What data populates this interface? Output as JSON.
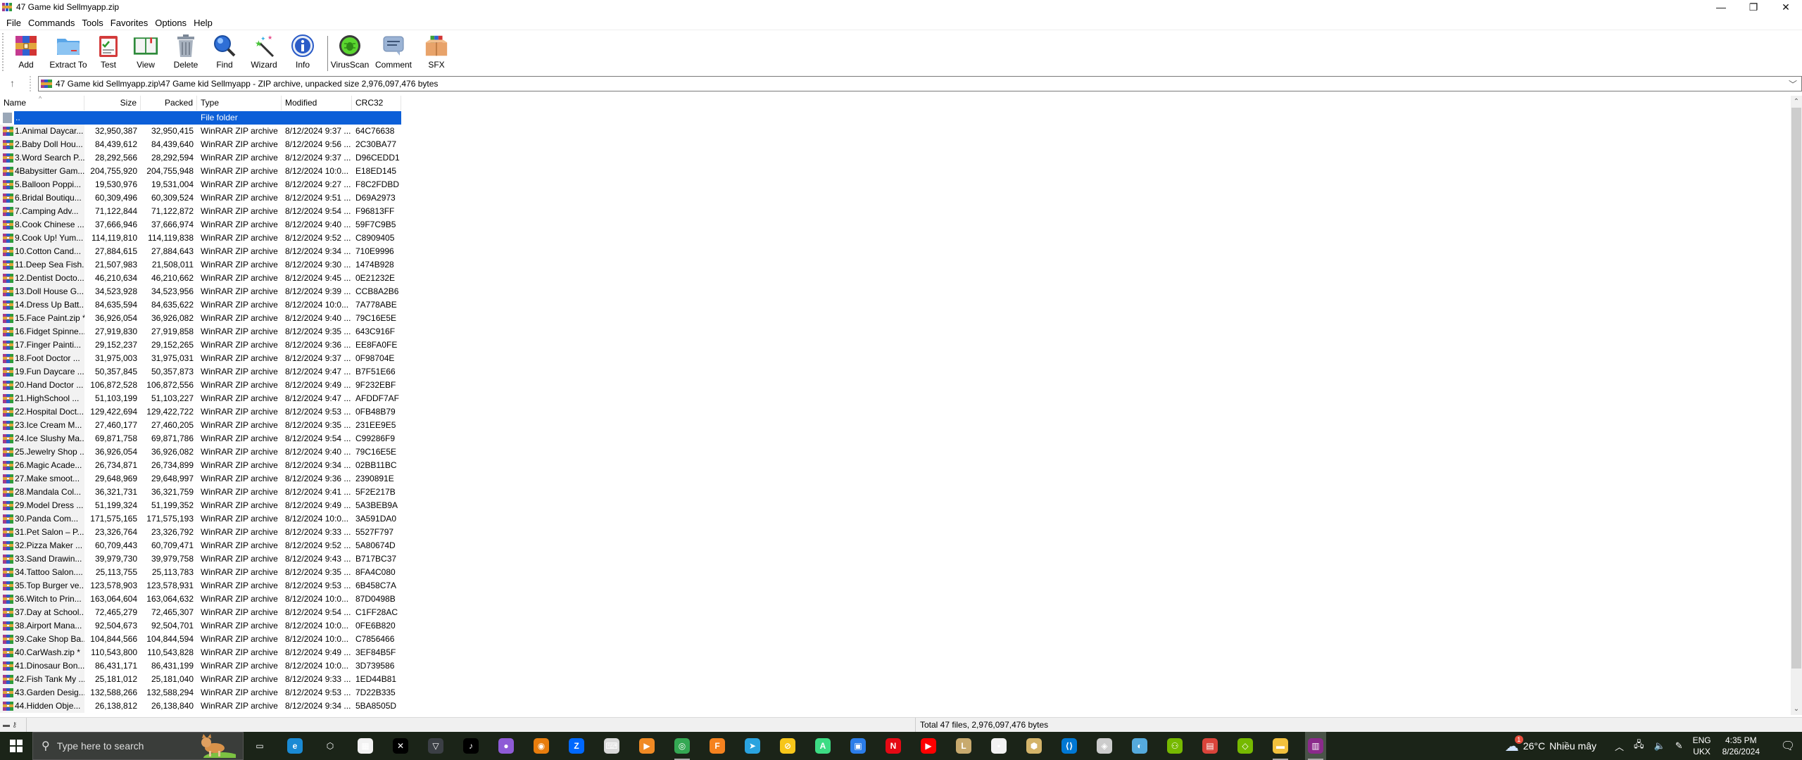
{
  "window": {
    "title": "47 Game kid Sellmyapp.zip",
    "controls": {
      "minimize": "—",
      "restore": "❐",
      "close": "✕"
    }
  },
  "menu": [
    "File",
    "Commands",
    "Tools",
    "Favorites",
    "Options",
    "Help"
  ],
  "toolbar": [
    {
      "label": "Add",
      "icon": "add-archive-icon"
    },
    {
      "label": "Extract To",
      "icon": "extract-folder-icon"
    },
    {
      "label": "Test",
      "icon": "test-clipboard-icon"
    },
    {
      "label": "View",
      "icon": "view-book-icon"
    },
    {
      "label": "Delete",
      "icon": "trash-icon"
    },
    {
      "label": "Find",
      "icon": "magnifier-icon"
    },
    {
      "label": "Wizard",
      "icon": "magic-wand-icon"
    },
    {
      "label": "Info",
      "icon": "info-icon"
    },
    {
      "label": "VirusScan",
      "icon": "virus-scan-icon"
    },
    {
      "label": "Comment",
      "icon": "comment-icon"
    },
    {
      "label": "SFX",
      "icon": "sfx-box-icon"
    }
  ],
  "address": {
    "path": "47 Game kid Sellmyapp.zip\\47 Game kid Sellmyapp - ZIP archive, unpacked size 2,976,097,476 bytes"
  },
  "columns": {
    "name": "Name",
    "size": "Size",
    "packed": "Packed",
    "type": "Type",
    "modified": "Modified",
    "crc": "CRC32"
  },
  "parent_row": {
    "name": "..",
    "type": "File folder"
  },
  "files": [
    {
      "name": "1.Animal Daycar...",
      "size": "32,950,387",
      "packed": "32,950,415",
      "type": "WinRAR ZIP archive",
      "modified": "8/12/2024 9:37 ...",
      "crc": "64C76638"
    },
    {
      "name": "2.Baby Doll Hou...",
      "size": "84,439,612",
      "packed": "84,439,640",
      "type": "WinRAR ZIP archive",
      "modified": "8/12/2024 9:56 ...",
      "crc": "2C30BA77"
    },
    {
      "name": "3.Word Search P...",
      "size": "28,292,566",
      "packed": "28,292,594",
      "type": "WinRAR ZIP archive",
      "modified": "8/12/2024 9:37 ...",
      "crc": "D96CEDD1"
    },
    {
      "name": "4Babysitter Gam...",
      "size": "204,755,920",
      "packed": "204,755,948",
      "type": "WinRAR ZIP archive",
      "modified": "8/12/2024 10:0...",
      "crc": "E18ED145"
    },
    {
      "name": "5.Balloon Poppi...",
      "size": "19,530,976",
      "packed": "19,531,004",
      "type": "WinRAR ZIP archive",
      "modified": "8/12/2024 9:27 ...",
      "crc": "F8C2FDBD"
    },
    {
      "name": "6.Bridal Boutiqu...",
      "size": "60,309,496",
      "packed": "60,309,524",
      "type": "WinRAR ZIP archive",
      "modified": "8/12/2024 9:51 ...",
      "crc": "D69A2973"
    },
    {
      "name": "7.Camping Adv...",
      "size": "71,122,844",
      "packed": "71,122,872",
      "type": "WinRAR ZIP archive",
      "modified": "8/12/2024 9:54 ...",
      "crc": "F96813FF"
    },
    {
      "name": "8.Cook Chinese ...",
      "size": "37,666,946",
      "packed": "37,666,974",
      "type": "WinRAR ZIP archive",
      "modified": "8/12/2024 9:40 ...",
      "crc": "59F7C9B5"
    },
    {
      "name": "9.Cook Up! Yum...",
      "size": "114,119,810",
      "packed": "114,119,838",
      "type": "WinRAR ZIP archive",
      "modified": "8/12/2024 9:52 ...",
      "crc": "C8909405"
    },
    {
      "name": "10.Cotton Cand...",
      "size": "27,884,615",
      "packed": "27,884,643",
      "type": "WinRAR ZIP archive",
      "modified": "8/12/2024 9:34 ...",
      "crc": "710E9996"
    },
    {
      "name": "11.Deep Sea Fish...",
      "size": "21,507,983",
      "packed": "21,508,011",
      "type": "WinRAR ZIP archive",
      "modified": "8/12/2024 9:30 ...",
      "crc": "1474B928"
    },
    {
      "name": "12.Dentist Docto...",
      "size": "46,210,634",
      "packed": "46,210,662",
      "type": "WinRAR ZIP archive",
      "modified": "8/12/2024 9:45 ...",
      "crc": "0E21232E"
    },
    {
      "name": "13.Doll House G...",
      "size": "34,523,928",
      "packed": "34,523,956",
      "type": "WinRAR ZIP archive",
      "modified": "8/12/2024 9:39 ...",
      "crc": "CCB8A2B6"
    },
    {
      "name": "14.Dress Up Batt...",
      "size": "84,635,594",
      "packed": "84,635,622",
      "type": "WinRAR ZIP archive",
      "modified": "8/12/2024 10:0...",
      "crc": "7A778ABE"
    },
    {
      "name": "15.Face Paint.zip *",
      "size": "36,926,054",
      "packed": "36,926,082",
      "type": "WinRAR ZIP archive",
      "modified": "8/12/2024 9:40 ...",
      "crc": "79C16E5E"
    },
    {
      "name": "16.Fidget Spinne...",
      "size": "27,919,830",
      "packed": "27,919,858",
      "type": "WinRAR ZIP archive",
      "modified": "8/12/2024 9:35 ...",
      "crc": "643C916F"
    },
    {
      "name": "17.Finger Painti...",
      "size": "29,152,237",
      "packed": "29,152,265",
      "type": "WinRAR ZIP archive",
      "modified": "8/12/2024 9:36 ...",
      "crc": "EE8FA0FE"
    },
    {
      "name": "18.Foot Doctor ...",
      "size": "31,975,003",
      "packed": "31,975,031",
      "type": "WinRAR ZIP archive",
      "modified": "8/12/2024 9:37 ...",
      "crc": "0F98704E"
    },
    {
      "name": "19.Fun Daycare ...",
      "size": "50,357,845",
      "packed": "50,357,873",
      "type": "WinRAR ZIP archive",
      "modified": "8/12/2024 9:47 ...",
      "crc": "B7F51E66"
    },
    {
      "name": "20.Hand Doctor ...",
      "size": "106,872,528",
      "packed": "106,872,556",
      "type": "WinRAR ZIP archive",
      "modified": "8/12/2024 9:49 ...",
      "crc": "9F232EBF"
    },
    {
      "name": "21.HighSchool ...",
      "size": "51,103,199",
      "packed": "51,103,227",
      "type": "WinRAR ZIP archive",
      "modified": "8/12/2024 9:47 ...",
      "crc": "AFDDF7AF"
    },
    {
      "name": "22.Hospital Doct...",
      "size": "129,422,694",
      "packed": "129,422,722",
      "type": "WinRAR ZIP archive",
      "modified": "8/12/2024 9:53 ...",
      "crc": "0FB48B79"
    },
    {
      "name": "23.Ice Cream M...",
      "size": "27,460,177",
      "packed": "27,460,205",
      "type": "WinRAR ZIP archive",
      "modified": "8/12/2024 9:35 ...",
      "crc": "231EE9E5"
    },
    {
      "name": "24.Ice Slushy Ma...",
      "size": "69,871,758",
      "packed": "69,871,786",
      "type": "WinRAR ZIP archive",
      "modified": "8/12/2024 9:54 ...",
      "crc": "C99286F9"
    },
    {
      "name": "25.Jewelry Shop ...",
      "size": "36,926,054",
      "packed": "36,926,082",
      "type": "WinRAR ZIP archive",
      "modified": "8/12/2024 9:40 ...",
      "crc": "79C16E5E"
    },
    {
      "name": "26.Magic Acade...",
      "size": "26,734,871",
      "packed": "26,734,899",
      "type": "WinRAR ZIP archive",
      "modified": "8/12/2024 9:34 ...",
      "crc": "02BB11BC"
    },
    {
      "name": "27.Make smoot...",
      "size": "29,648,969",
      "packed": "29,648,997",
      "type": "WinRAR ZIP archive",
      "modified": "8/12/2024 9:36 ...",
      "crc": "2390891E"
    },
    {
      "name": "28.Mandala Col...",
      "size": "36,321,731",
      "packed": "36,321,759",
      "type": "WinRAR ZIP archive",
      "modified": "8/12/2024 9:41 ...",
      "crc": "5F2E217B"
    },
    {
      "name": "29.Model Dress ...",
      "size": "51,199,324",
      "packed": "51,199,352",
      "type": "WinRAR ZIP archive",
      "modified": "8/12/2024 9:49 ...",
      "crc": "5A3BEB9A"
    },
    {
      "name": "30.Panda Com...",
      "size": "171,575,165",
      "packed": "171,575,193",
      "type": "WinRAR ZIP archive",
      "modified": "8/12/2024 10:0...",
      "crc": "3A591DA0"
    },
    {
      "name": "31.Pet Salon – P...",
      "size": "23,326,764",
      "packed": "23,326,792",
      "type": "WinRAR ZIP archive",
      "modified": "8/12/2024 9:33 ...",
      "crc": "5527F797"
    },
    {
      "name": "32.Pizza Maker ...",
      "size": "60,709,443",
      "packed": "60,709,471",
      "type": "WinRAR ZIP archive",
      "modified": "8/12/2024 9:52 ...",
      "crc": "5A80674D"
    },
    {
      "name": "33.Sand Drawin...",
      "size": "39,979,730",
      "packed": "39,979,758",
      "type": "WinRAR ZIP archive",
      "modified": "8/12/2024 9:43 ...",
      "crc": "B717BC37"
    },
    {
      "name": "34.Tattoo Salon....",
      "size": "25,113,755",
      "packed": "25,113,783",
      "type": "WinRAR ZIP archive",
      "modified": "8/12/2024 9:35 ...",
      "crc": "8FA4C080"
    },
    {
      "name": "35.Top Burger ve...",
      "size": "123,578,903",
      "packed": "123,578,931",
      "type": "WinRAR ZIP archive",
      "modified": "8/12/2024 9:53 ...",
      "crc": "6B458C7A"
    },
    {
      "name": "36.Witch to Prin...",
      "size": "163,064,604",
      "packed": "163,064,632",
      "type": "WinRAR ZIP archive",
      "modified": "8/12/2024 10:0...",
      "crc": "87D0498B"
    },
    {
      "name": "37.Day at School...",
      "size": "72,465,279",
      "packed": "72,465,307",
      "type": "WinRAR ZIP archive",
      "modified": "8/12/2024 9:54 ...",
      "crc": "C1FF28AC"
    },
    {
      "name": "38.Airport Mana...",
      "size": "92,504,673",
      "packed": "92,504,701",
      "type": "WinRAR ZIP archive",
      "modified": "8/12/2024 10:0...",
      "crc": "0FE6B820"
    },
    {
      "name": "39.Cake Shop Ba...",
      "size": "104,844,566",
      "packed": "104,844,594",
      "type": "WinRAR ZIP archive",
      "modified": "8/12/2024 10:0...",
      "crc": "C7856466"
    },
    {
      "name": "40.CarWash.zip *",
      "size": "110,543,800",
      "packed": "110,543,828",
      "type": "WinRAR ZIP archive",
      "modified": "8/12/2024 9:49 ...",
      "crc": "3EF84B5F"
    },
    {
      "name": "41.Dinosaur Bon...",
      "size": "86,431,171",
      "packed": "86,431,199",
      "type": "WinRAR ZIP archive",
      "modified": "8/12/2024 10:0...",
      "crc": "3D739586"
    },
    {
      "name": "42.Fish Tank My ...",
      "size": "25,181,012",
      "packed": "25,181,040",
      "type": "WinRAR ZIP archive",
      "modified": "8/12/2024 9:33 ...",
      "crc": "1ED44B81"
    },
    {
      "name": "43.Garden Desig...",
      "size": "132,588,266",
      "packed": "132,588,294",
      "type": "WinRAR ZIP archive",
      "modified": "8/12/2024 9:53 ...",
      "crc": "7D22B335"
    },
    {
      "name": "44.Hidden Obje...",
      "size": "26,138,812",
      "packed": "26,138,840",
      "type": "WinRAR ZIP archive",
      "modified": "8/12/2024 9:34 ...",
      "crc": "5BA8505D"
    }
  ],
  "status": {
    "text": "Total 47 files, 2,976,097,476 bytes"
  },
  "taskbar": {
    "search_placeholder": "Type here to search",
    "apps": [
      {
        "name": "task-view",
        "glyph": "▭",
        "color": "#1b2418"
      },
      {
        "name": "edge",
        "glyph": "e",
        "color": "#1a8ad4"
      },
      {
        "name": "3d-viewer",
        "glyph": "⬡",
        "color": "#1b2418"
      },
      {
        "name": "microsoft-store",
        "glyph": "▦",
        "color": "#f2f2f2"
      },
      {
        "name": "capcut",
        "glyph": "✕",
        "color": "#000000"
      },
      {
        "name": "vectorizer",
        "glyph": "▽",
        "color": "#3b3f45"
      },
      {
        "name": "tiktok",
        "glyph": "♪",
        "color": "#000000"
      },
      {
        "name": "paint-drop",
        "glyph": "●",
        "color": "#8e5bd6"
      },
      {
        "name": "blender",
        "glyph": "◉",
        "color": "#e87d0d"
      },
      {
        "name": "zalo",
        "glyph": "Z",
        "color": "#0068ff"
      },
      {
        "name": "keyboard-tool",
        "glyph": "⌨",
        "color": "#d9d9d9"
      },
      {
        "name": "media-player",
        "glyph": "▶",
        "color": "#f08a24"
      },
      {
        "name": "chrome",
        "glyph": "◎",
        "color": "#34a853"
      },
      {
        "name": "fl-studio",
        "glyph": "F",
        "color": "#f5821f"
      },
      {
        "name": "telegram",
        "glyph": "➤",
        "color": "#2aa3df"
      },
      {
        "name": "ld-player",
        "glyph": "⊘",
        "color": "#f7c61a"
      },
      {
        "name": "android-studio",
        "glyph": "A",
        "color": "#3ddc84"
      },
      {
        "name": "remote-desktop",
        "glyph": "▣",
        "color": "#2b7de9"
      },
      {
        "name": "netflix",
        "glyph": "N",
        "color": "#e50914"
      },
      {
        "name": "youtube",
        "glyph": "▶",
        "color": "#ff0000"
      },
      {
        "name": "league-of-legends",
        "glyph": "L",
        "color": "#c8aa6e"
      },
      {
        "name": "pixel-app",
        "glyph": "▪",
        "color": "#f2f2f2"
      },
      {
        "name": "hex-app",
        "glyph": "⬢",
        "color": "#d4b46a"
      },
      {
        "name": "vscode",
        "glyph": "⟨⟩",
        "color": "#0078d4"
      },
      {
        "name": "unity",
        "glyph": "◈",
        "color": "#cccccc"
      },
      {
        "name": "cocos",
        "glyph": "◐",
        "color": "#55aadd"
      },
      {
        "name": "nvidia-team",
        "glyph": "⚇",
        "color": "#76b900"
      },
      {
        "name": "firewall",
        "glyph": "▤",
        "color": "#d9443a"
      },
      {
        "name": "nvidia-geforce",
        "glyph": "◇",
        "color": "#76b900"
      },
      {
        "name": "file-explorer",
        "glyph": "▬",
        "color": "#f2c13d"
      },
      {
        "name": "winrar",
        "glyph": "▥",
        "color": "#8b2a8b",
        "active": true
      }
    ],
    "weather": {
      "temp": "26°C",
      "desc": "Nhiều mây",
      "badge": "1"
    },
    "lang": {
      "line1": "ENG",
      "line2": "UKX"
    },
    "clock": {
      "time": "4:35 PM",
      "date": "8/26/2024"
    }
  }
}
